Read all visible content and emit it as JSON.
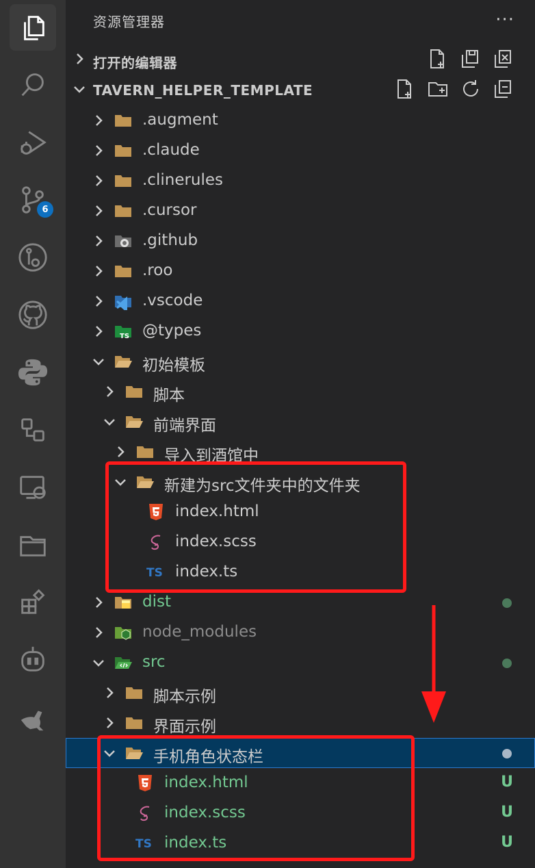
{
  "explorer": {
    "title": "资源管理器",
    "open_editors_label": "打开的编辑器",
    "workspace_label": "TAVERN_HELPER_TEMPLATE"
  },
  "activity_bar": {
    "scm_badge": "6"
  },
  "tree": [
    {
      "label": ".augment"
    },
    {
      "label": ".claude"
    },
    {
      "label": ".clinerules"
    },
    {
      "label": ".cursor"
    },
    {
      "label": ".github"
    },
    {
      "label": ".roo"
    },
    {
      "label": ".vscode"
    },
    {
      "label": "@types"
    },
    {
      "label": "初始模板"
    },
    {
      "label": "脚本"
    },
    {
      "label": "前端界面"
    },
    {
      "label": "导入到酒馆中"
    },
    {
      "label": "新建为src文件夹中的文件夹"
    },
    {
      "label": "index.html"
    },
    {
      "label": "index.scss"
    },
    {
      "label": "index.ts"
    },
    {
      "label": "dist"
    },
    {
      "label": "node_modules"
    },
    {
      "label": "src"
    },
    {
      "label": "脚本示例"
    },
    {
      "label": "界面示例"
    },
    {
      "label": "手机角色状态栏"
    },
    {
      "label": "index.html",
      "status": "U"
    },
    {
      "label": "index.scss",
      "status": "U"
    },
    {
      "label": "index.ts",
      "status": "U"
    }
  ],
  "colors": {
    "folder": "#c09553",
    "git_added": "#73c991",
    "annotation_red": "#ff1a1a",
    "selection": "#04395e"
  }
}
